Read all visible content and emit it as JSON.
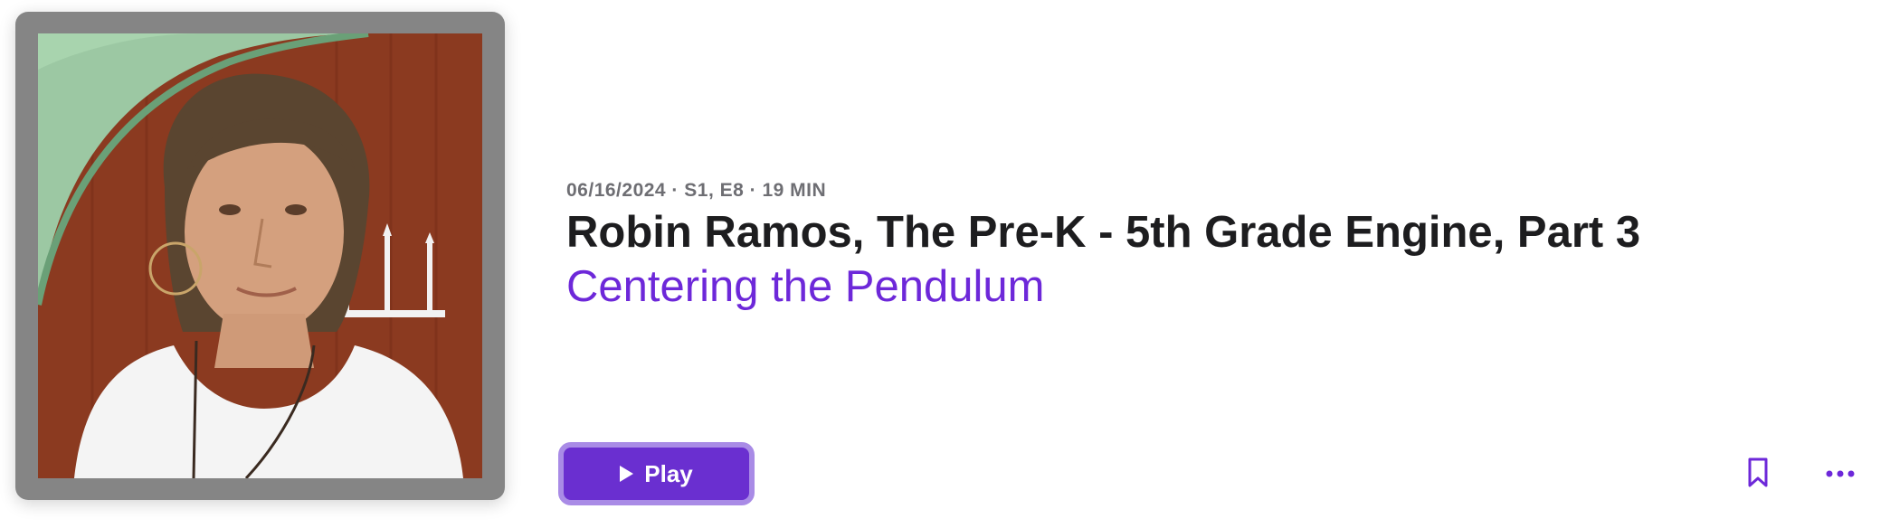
{
  "episode": {
    "meta": "06/16/2024 · S1, E8 · 19 MIN",
    "title": "Robin Ramos, The Pre-K - 5th Grade Engine, Part 3",
    "show_name": "Centering the Pendulum"
  },
  "actions": {
    "play_label": "Play",
    "play_icon": "play-icon",
    "bookmark_icon": "bookmark-icon",
    "more_icon": "ellipsis-icon"
  },
  "colors": {
    "accent": "#6d28d9",
    "play_button": "#6a2fd0",
    "play_border": "#a98be6",
    "meta_text": "#6e6e73",
    "title_text": "#1d1d1f",
    "artwork_frame": "#858585"
  }
}
